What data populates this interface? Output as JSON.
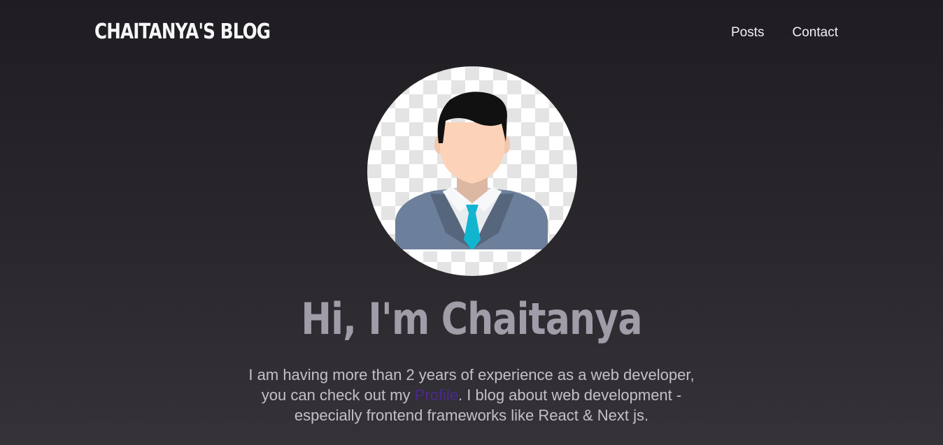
{
  "header": {
    "logo": "CHAITANYA'S BLOG",
    "nav": [
      {
        "label": "Posts"
      },
      {
        "label": "Contact"
      }
    ]
  },
  "hero": {
    "avatar_icon": "businessman-avatar-icon",
    "title": "Hi, I'm Chaitanya",
    "intro_before": "I am having more than 2 years of experience as a web developer, you can check out my ",
    "intro_link": "Profile",
    "intro_after": ". I blog about web development - especially frontend frameworks like React & Next js."
  },
  "colors": {
    "background": "#2a272d",
    "title": "#a19ca7",
    "link": "#4a2a8c"
  }
}
